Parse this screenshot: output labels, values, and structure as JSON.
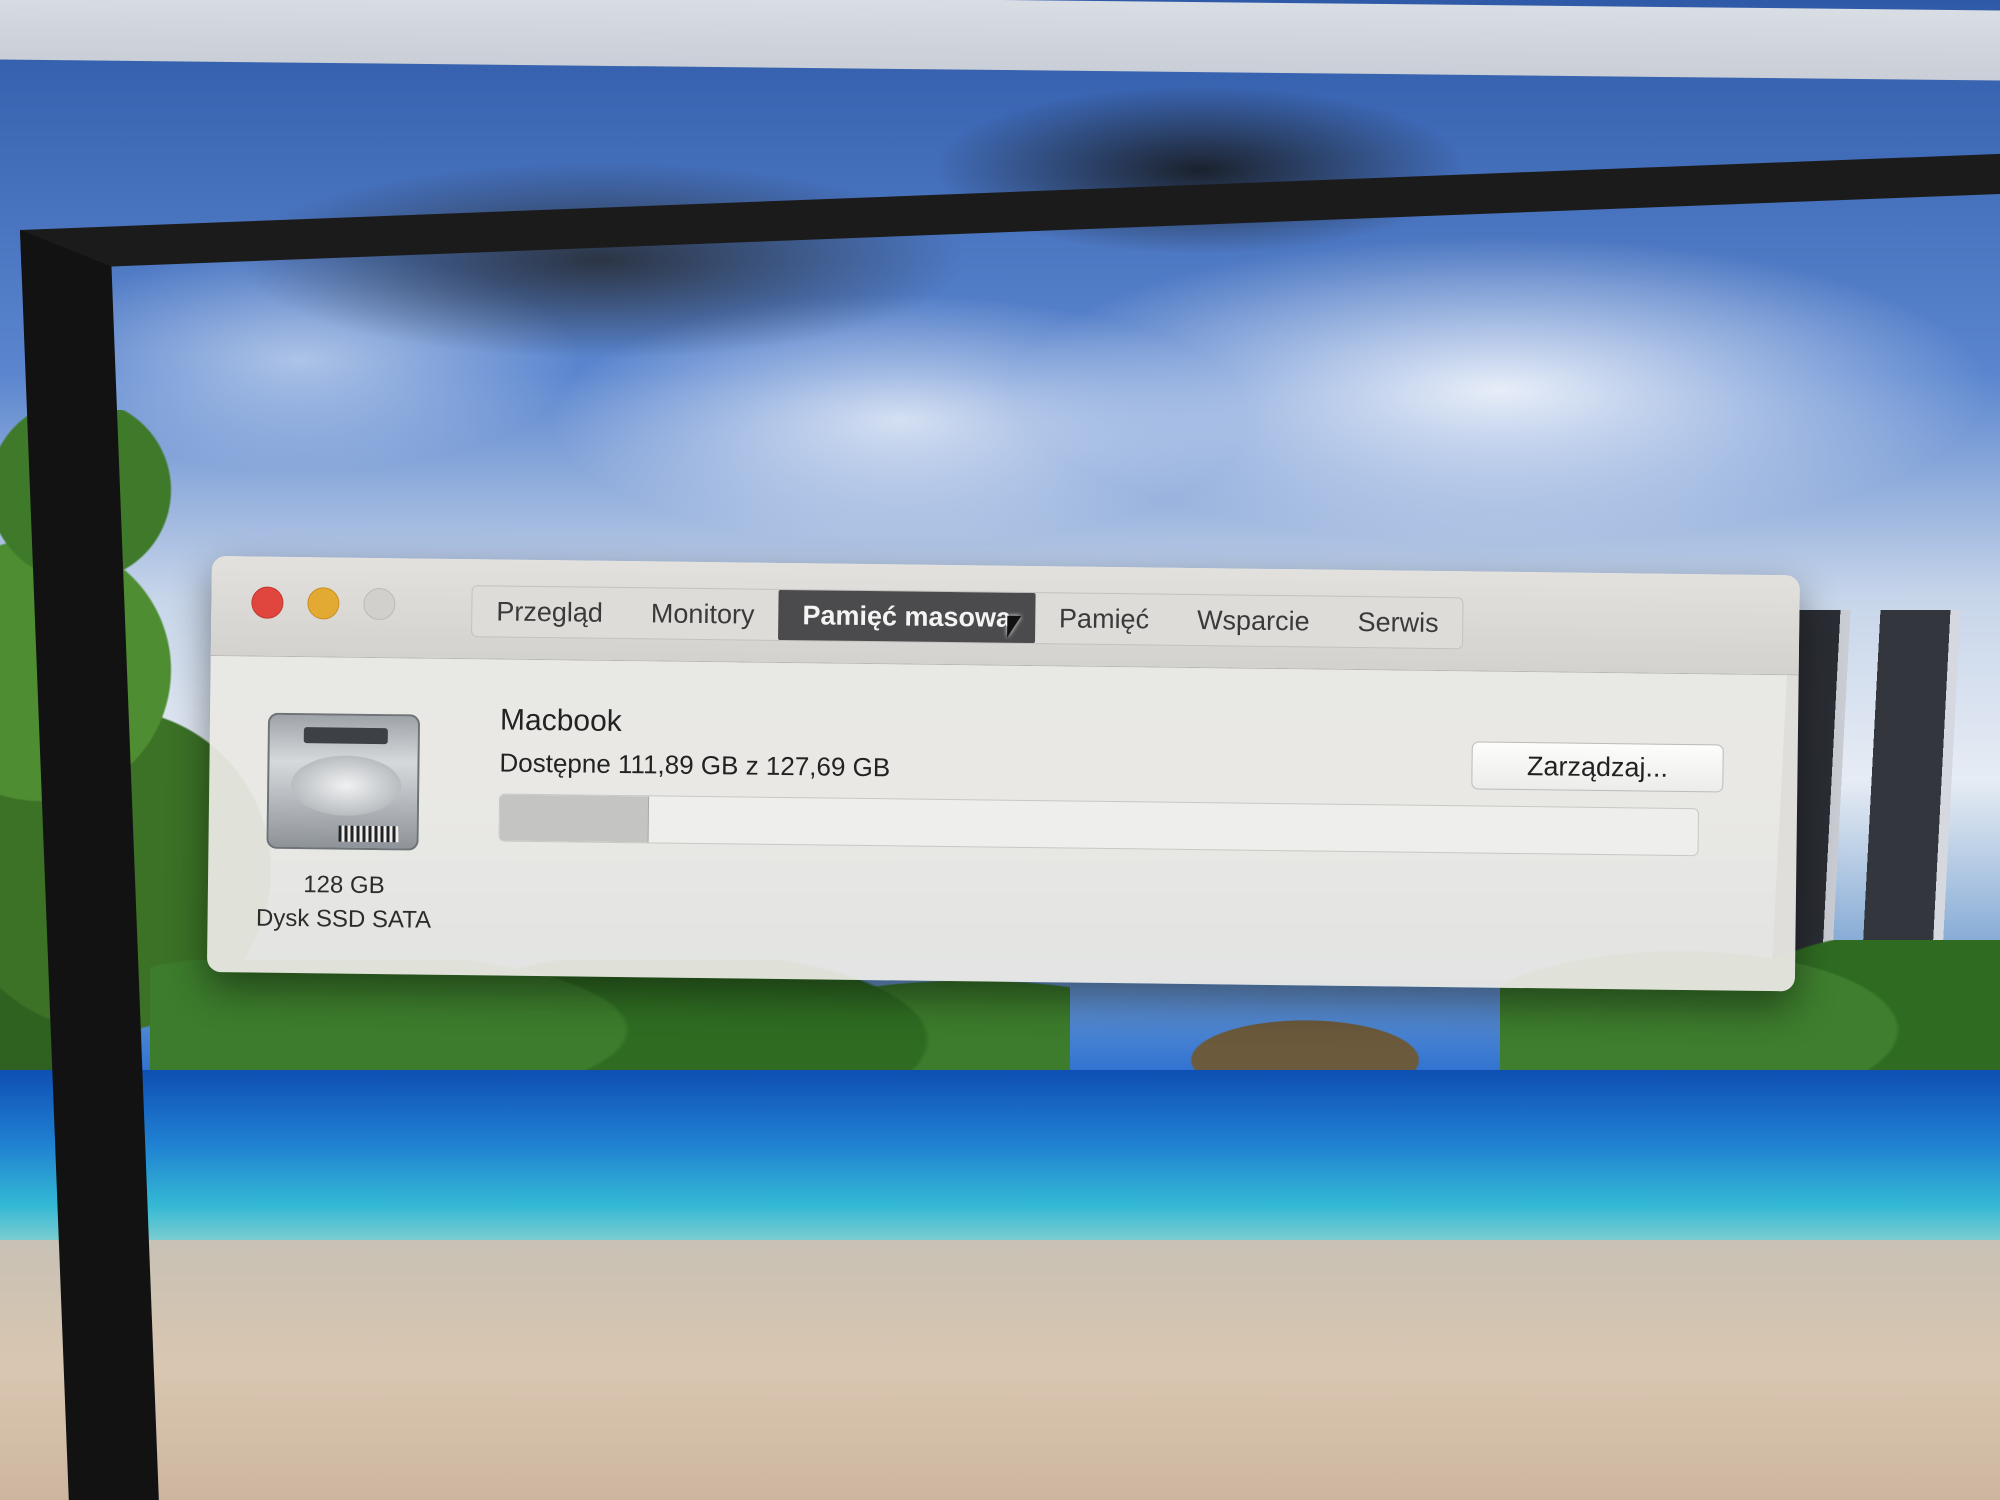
{
  "window": {
    "tabs": [
      {
        "label": "Przegląd",
        "active": false
      },
      {
        "label": "Monitory",
        "active": false
      },
      {
        "label": "Pamięć masowa",
        "active": true
      },
      {
        "label": "Pamięć",
        "active": false
      },
      {
        "label": "Wsparcie",
        "active": false
      },
      {
        "label": "Serwis",
        "active": false
      }
    ]
  },
  "storage": {
    "icon": "hard-drive-icon",
    "capacity": "128 GB",
    "kind": "Dysk SSD SATA",
    "volume_name": "Macbook",
    "availability": "Dostępne 111,89 GB z 127,69 GB",
    "used_fraction": 0.124,
    "manage_label": "Zarządzaj..."
  },
  "colors": {
    "close": "#e0453e",
    "minimize": "#e3aa33",
    "zoom": "#d2d0cc",
    "active_tab": "#4b4b4d"
  }
}
